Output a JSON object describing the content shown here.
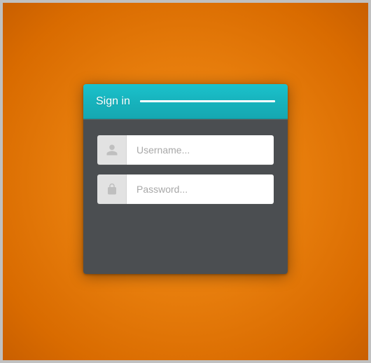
{
  "signin": {
    "title": "Sign in",
    "username": {
      "placeholder": "Username...",
      "value": ""
    },
    "password": {
      "placeholder": "Password...",
      "value": ""
    }
  }
}
